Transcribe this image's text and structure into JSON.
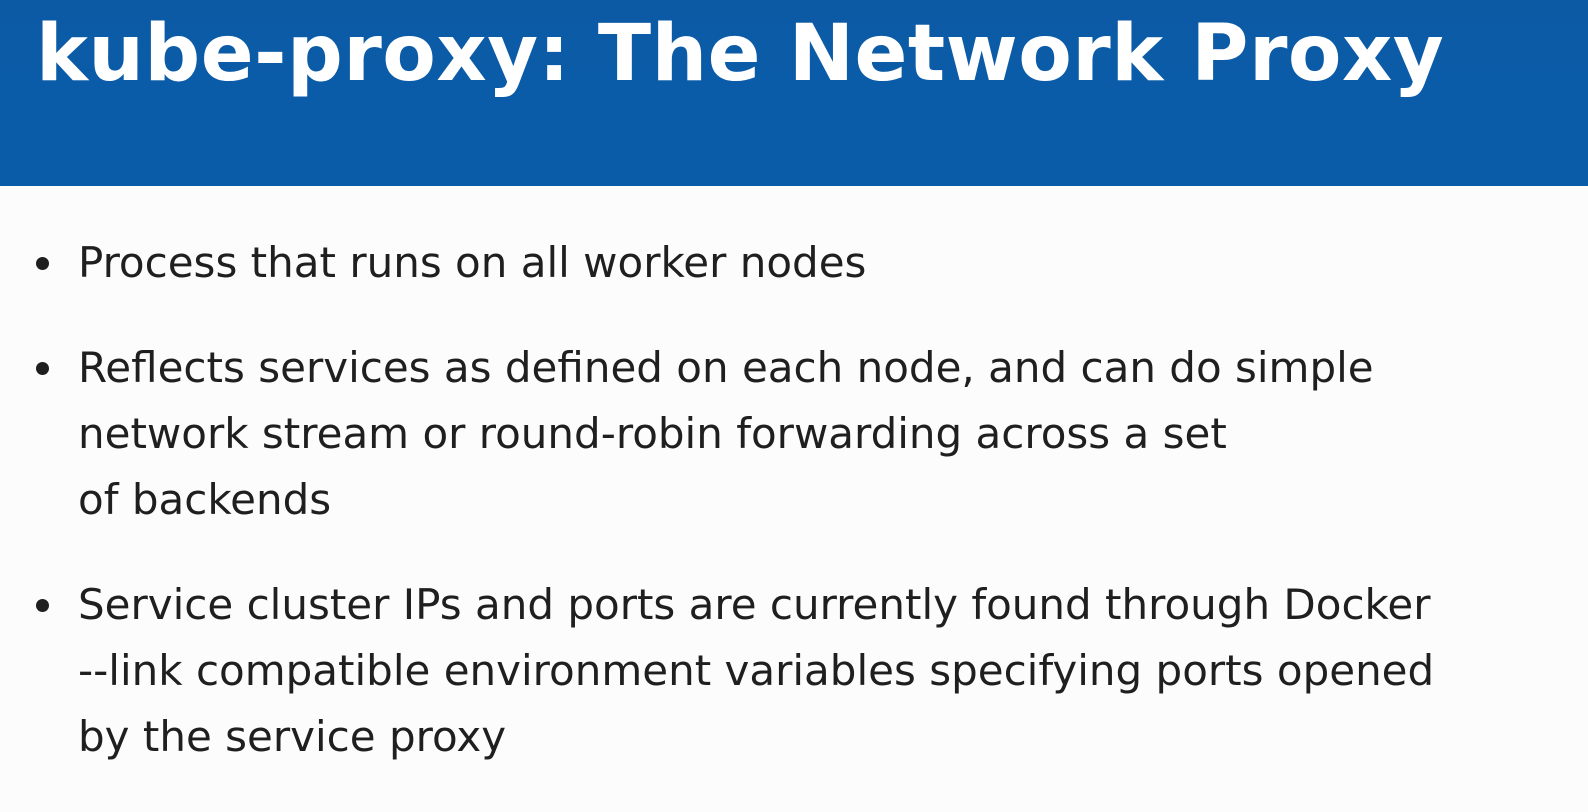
{
  "slide": {
    "title": "kube-proxy: The Network Proxy",
    "bullets": [
      {
        "lines": [
          "Process that runs on all worker nodes"
        ]
      },
      {
        "lines": [
          "Reflects services as defined on each node, and can do simple",
          "network stream or round-robin forwarding across a set",
          "of backends"
        ]
      },
      {
        "lines": [
          "Service cluster IPs and ports are currently found through Docker",
          "--link compatible environment variables specifying ports opened",
          "by the service proxy"
        ]
      }
    ]
  },
  "colors": {
    "title_bar": "#0a5ba8",
    "title_text": "#ffffff",
    "body_background": "#fcfcfc",
    "body_text": "#1f1f1f"
  }
}
